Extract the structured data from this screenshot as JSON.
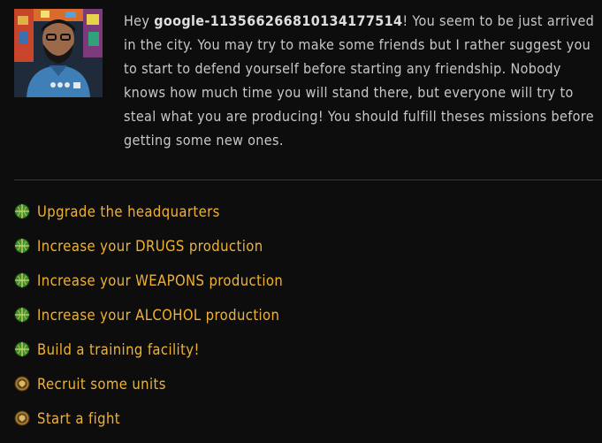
{
  "intro": {
    "greeting_prefix": "Hey ",
    "username": "google-113566266810134177514",
    "message_rest": "! You seem to be just arrived in the city. You may try to make some friends but I rather suggest you to start to defend yourself before starting any friendship. Nobody knows how much time you will stand there, but everyone will try to steal what you are producing! You should fulfill theses missions before getting some new ones."
  },
  "missions": [
    {
      "label": "Upgrade the headquarters",
      "icon": "globe-icon"
    },
    {
      "label": "Increase your DRUGS production",
      "icon": "globe-icon"
    },
    {
      "label": "Increase your WEAPONS production",
      "icon": "globe-icon"
    },
    {
      "label": "Increase your ALCOHOL production",
      "icon": "globe-icon"
    },
    {
      "label": "Build a training facility!",
      "icon": "globe-icon"
    },
    {
      "label": "Recruit some units",
      "icon": "shield-badge-icon"
    },
    {
      "label": "Start a fight",
      "icon": "shield-badge-icon"
    }
  ],
  "colors": {
    "background": "#0d0d0d",
    "mission_link": "#f0b232",
    "body_text": "#c8c8c8"
  }
}
